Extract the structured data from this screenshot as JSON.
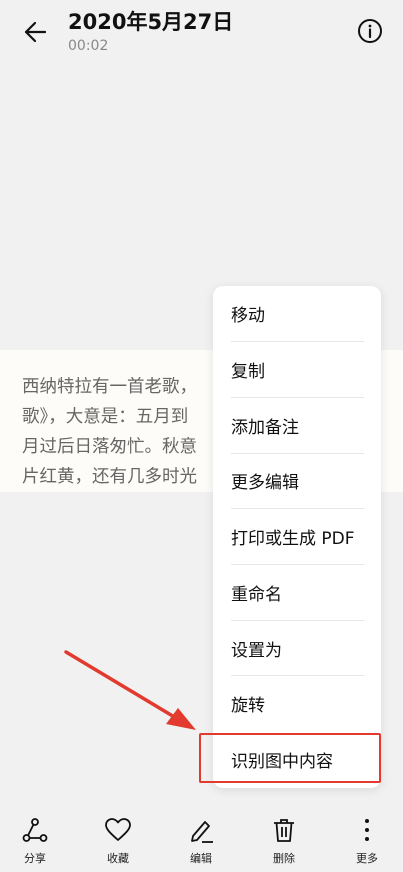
{
  "header": {
    "title": "2020年5月27日",
    "subtitle": "00:02"
  },
  "photo": {
    "lines": [
      "西纳特拉有一首老歌，",
      "歌》，大意是：五月到",
      "月过后日落匆忙。秋意",
      "片红黄，还有几多时光"
    ]
  },
  "menu": {
    "items": [
      "移动",
      "复制",
      "添加备注",
      "更多编辑",
      "打印或生成 PDF",
      "重命名",
      "设置为",
      "旋转",
      "识别图中内容"
    ],
    "highlighted_index": 8
  },
  "bottom_bar": {
    "tabs": [
      {
        "label": "分享",
        "icon": "share-icon"
      },
      {
        "label": "收藏",
        "icon": "heart-icon"
      },
      {
        "label": "编辑",
        "icon": "pencil-icon"
      },
      {
        "label": "删除",
        "icon": "trash-icon"
      },
      {
        "label": "更多",
        "icon": "more-vertical-icon"
      }
    ]
  },
  "colors": {
    "background": "#f1f1f1",
    "highlight": "#e23a2e",
    "menu_bg": "#ffffff"
  }
}
